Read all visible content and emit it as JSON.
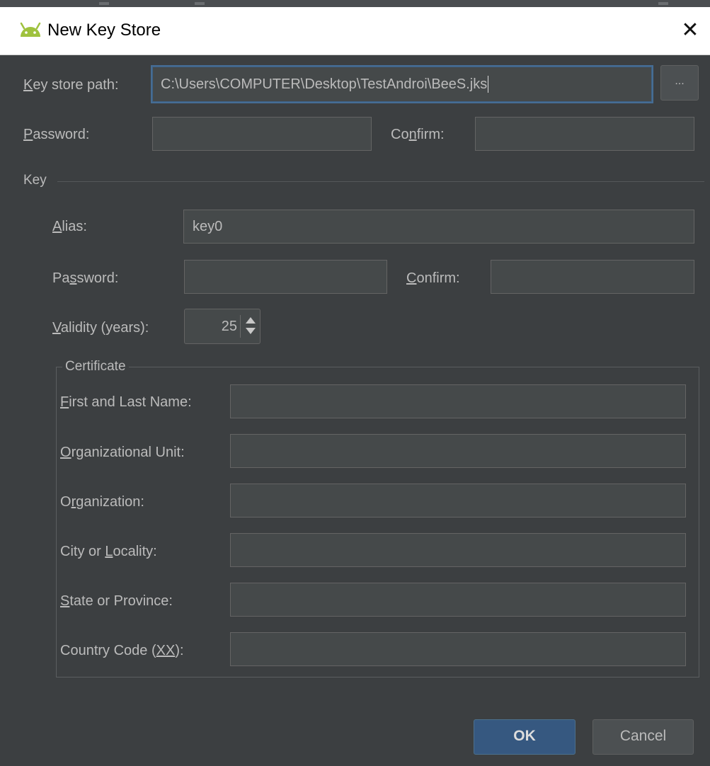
{
  "window": {
    "title": "New Key Store",
    "close_glyph": "✕"
  },
  "keystore": {
    "path_label_pre": "",
    "path_label_m": "K",
    "path_label_post": "ey store path:",
    "path_value": "C:\\Users\\COMPUTER\\Desktop\\TestAndroi\\BeeS.jks",
    "browse_label": "...",
    "password_label_pre": "",
    "password_label_m": "P",
    "password_label_post": "assword:",
    "password_value": "",
    "confirm_label_pre": "Co",
    "confirm_label_m": "n",
    "confirm_label_post": "firm:",
    "confirm_value": ""
  },
  "key": {
    "section_title": "Key",
    "alias_label_pre": "",
    "alias_label_m": "A",
    "alias_label_post": "lias:",
    "alias_value": "key0",
    "password_label_pre": "Pa",
    "password_label_m": "s",
    "password_label_post": "sword:",
    "password_value": "",
    "confirm_label_pre": "",
    "confirm_label_m": "C",
    "confirm_label_post": "onfirm:",
    "confirm_value": "",
    "validity_label_pre": "",
    "validity_label_m": "V",
    "validity_label_post": "alidity (years):",
    "validity_value": "25"
  },
  "certificate": {
    "title": "Certificate",
    "fields": [
      {
        "pre": "",
        "m": "F",
        "post": "irst and Last Name:",
        "value": ""
      },
      {
        "pre": "",
        "m": "O",
        "post": "rganizational Unit:",
        "value": ""
      },
      {
        "pre": "O",
        "m": "r",
        "post": "ganization:",
        "value": ""
      },
      {
        "pre": "City or ",
        "m": "L",
        "post": "ocality:",
        "value": ""
      },
      {
        "pre": "",
        "m": "S",
        "post": "tate or Province:",
        "value": ""
      },
      {
        "pre": "Country Code (",
        "m": "XX",
        "post": "):",
        "value": ""
      }
    ]
  },
  "buttons": {
    "ok": "OK",
    "cancel": "Cancel"
  },
  "colors": {
    "background": "#3c3f41",
    "field_bg": "#45494a",
    "focus_border": "#466d94",
    "primary_button": "#365880",
    "text": "#bbbbbb"
  }
}
